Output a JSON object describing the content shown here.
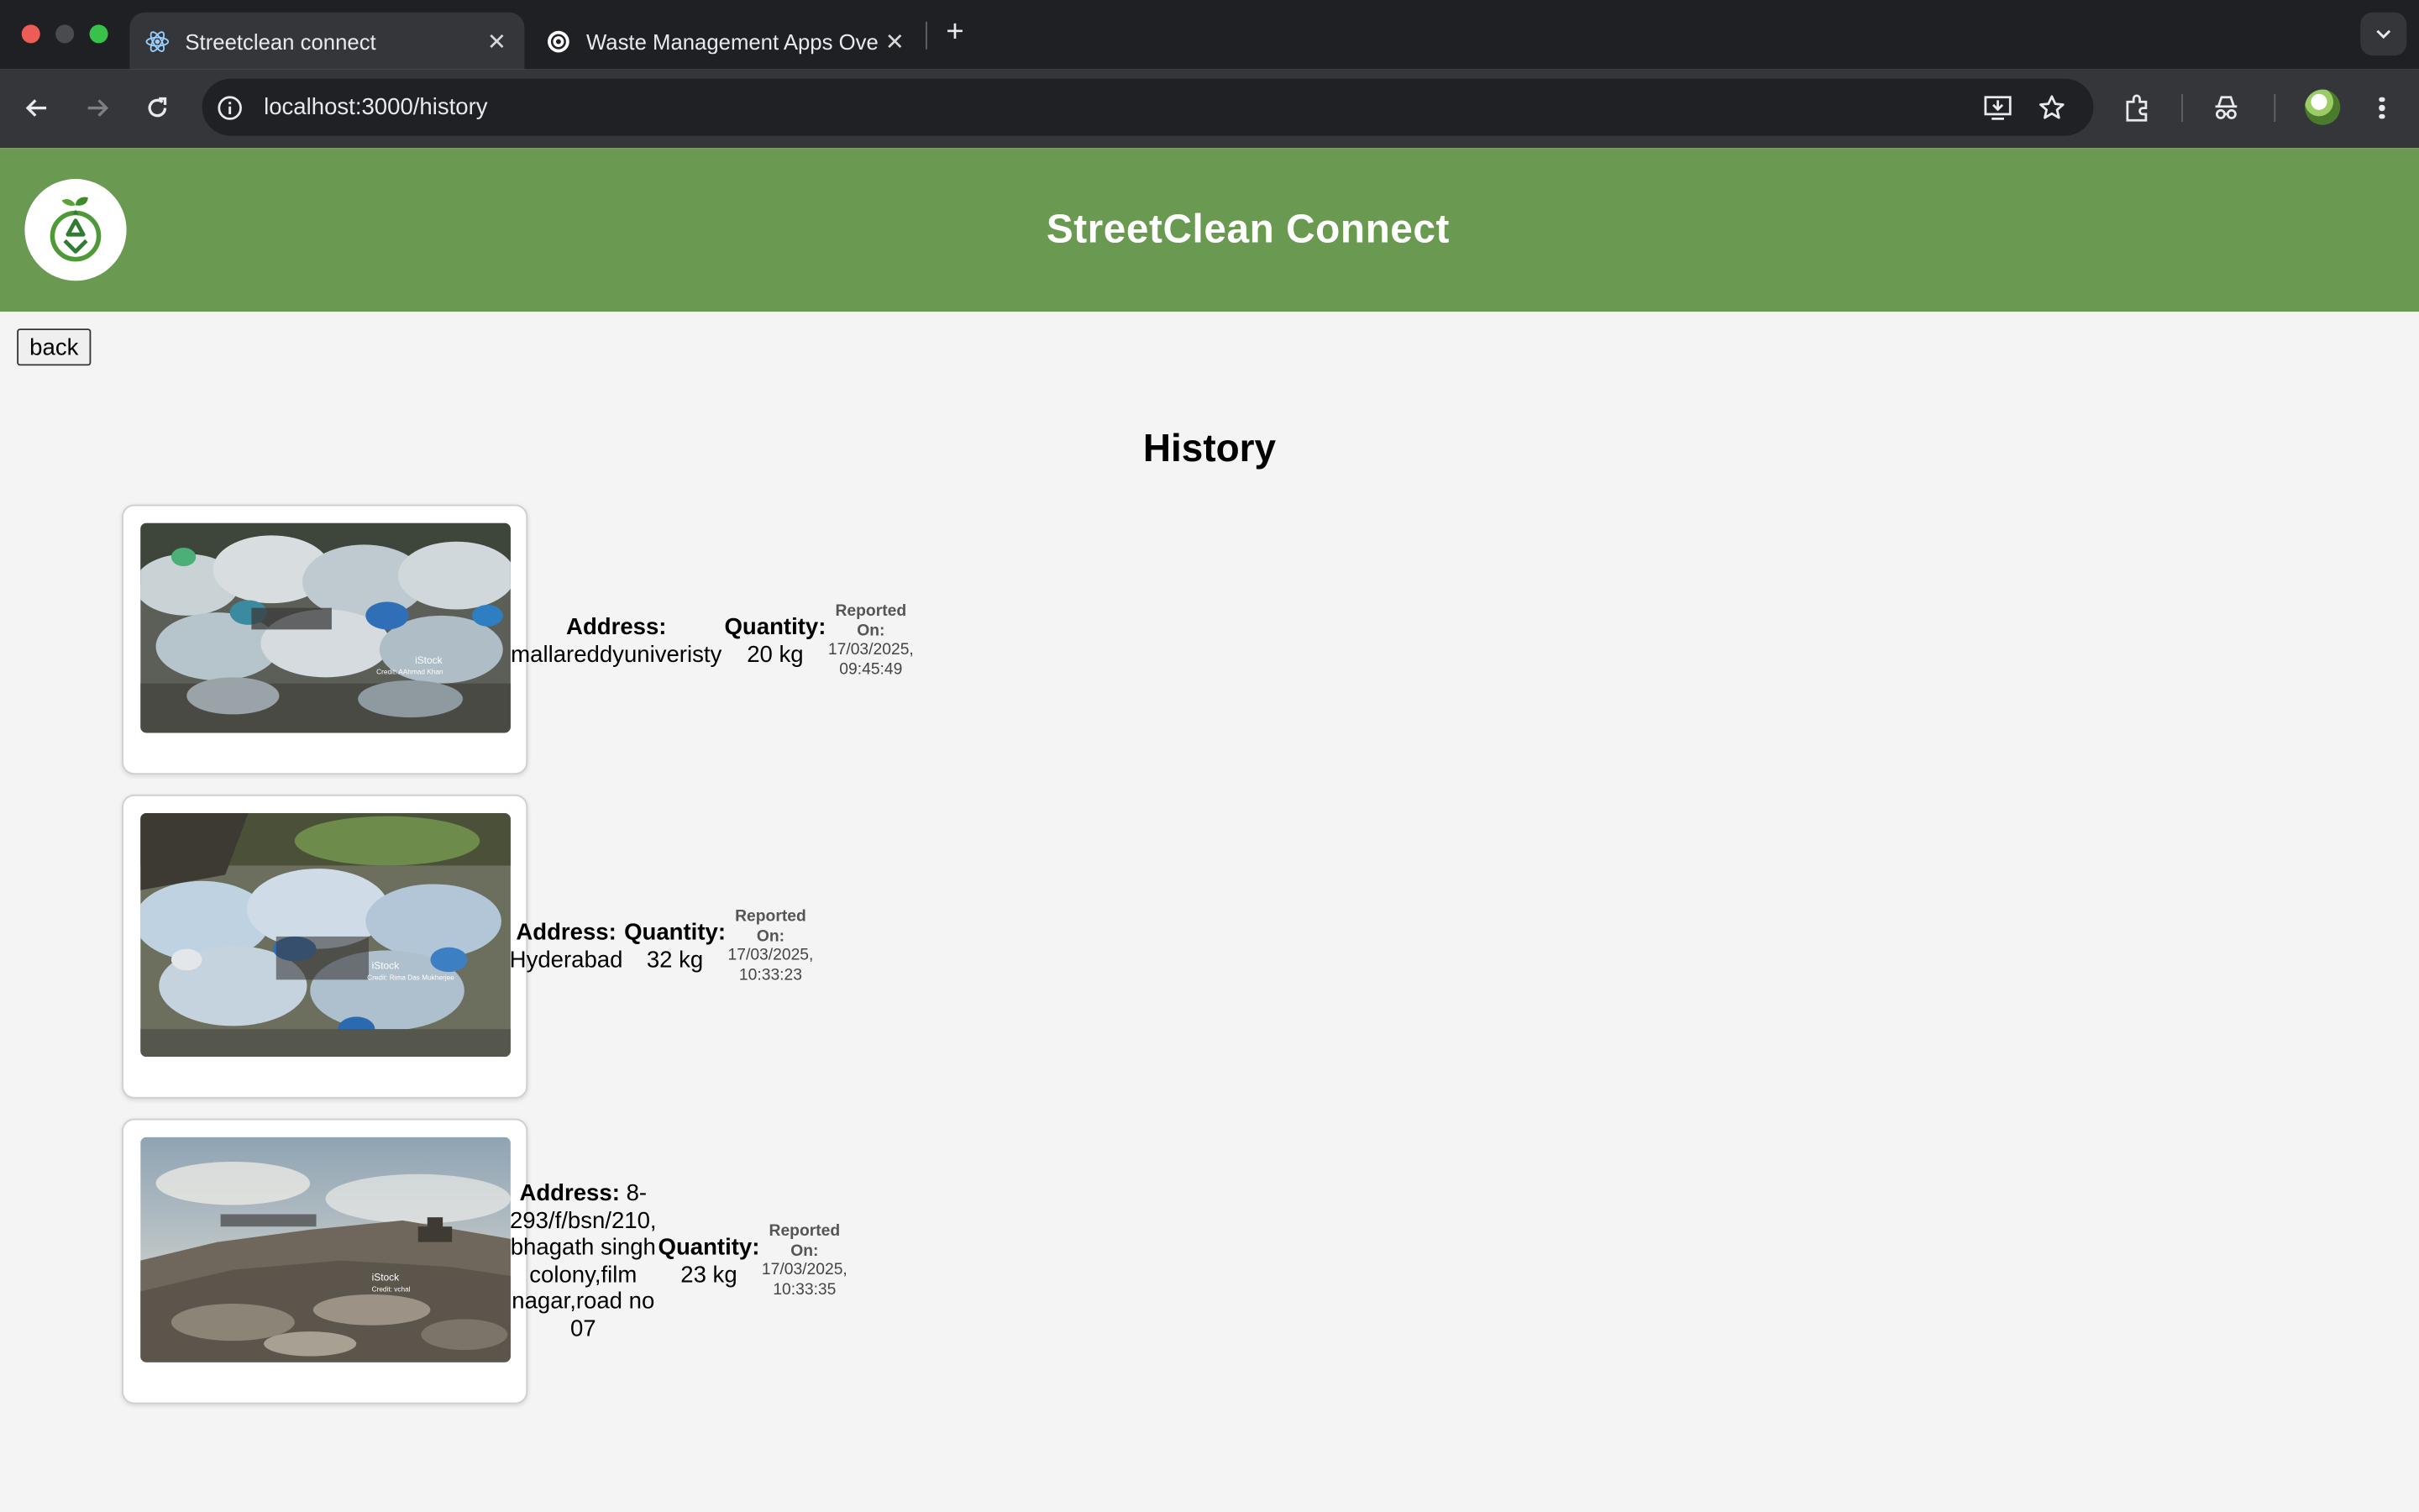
{
  "browser": {
    "tabs": [
      {
        "title": "Streetclean connect",
        "active": true
      },
      {
        "title": "Waste Management Apps Ove",
        "active": false
      }
    ],
    "url": "localhost:3000/history"
  },
  "header": {
    "title": "StreetClean Connect",
    "logo_icon": "recycle-leaf-icon"
  },
  "back_label": "back",
  "page_title": "History",
  "labels": {
    "address": "Address:",
    "quantity": "Quantity:",
    "reported_on_1": "Reported",
    "reported_on_2": "On:"
  },
  "reports": [
    {
      "address_lines": [
        "mallareddyuniveristy"
      ],
      "quantity": "20 kg",
      "date": "17/03/2025,",
      "time": "09:45:49",
      "image_caption": "iStock",
      "image_credit": "Credit: AAhmad Khan"
    },
    {
      "address_lines": [
        "Hyderabad"
      ],
      "quantity": "32 kg",
      "date": "17/03/2025,",
      "time": "10:33:23",
      "image_caption": "iStock",
      "image_credit": "Credit: Rima Das Mukherjee"
    },
    {
      "address_lines": [
        "8-",
        "293/f/bsn/210,",
        "bhagath singh",
        "colony,film",
        "nagar,road no",
        "07"
      ],
      "quantity": "23 kg",
      "date": "17/03/2025,",
      "time": "10:33:35",
      "image_caption": "iStock",
      "image_credit": "Credit: vchal"
    }
  ]
}
